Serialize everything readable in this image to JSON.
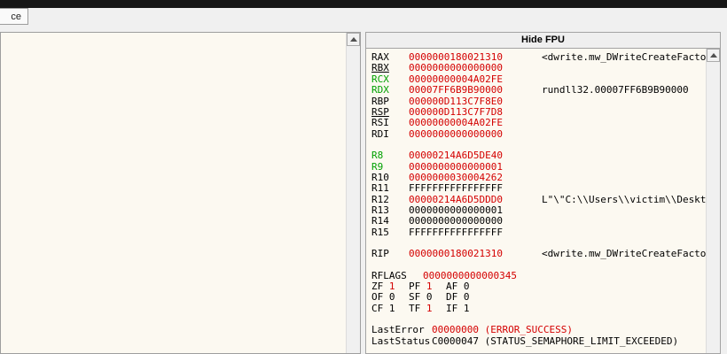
{
  "colors": {
    "red": "#d40000",
    "green": "#00a000",
    "black": "#000000",
    "panel_bg": "#fcf9f1",
    "chrome": "#f0f0f0"
  },
  "tab_fragment": "ce",
  "fpu_button": "Hide FPU",
  "registers": [
    {
      "name": "RAX",
      "name_color": "black",
      "underline": false,
      "value": "0000000180021310",
      "value_color": "red",
      "comment": "<dwrite.mw_DWriteCreateFacto",
      "gap_before": false
    },
    {
      "name": "RBX",
      "name_color": "black",
      "underline": true,
      "value": "0000000000000000",
      "value_color": "red",
      "comment": "",
      "gap_before": false
    },
    {
      "name": "RCX",
      "name_color": "green",
      "underline": false,
      "value": "00000000004A02FE",
      "value_color": "red",
      "comment": "",
      "gap_before": false
    },
    {
      "name": "RDX",
      "name_color": "green",
      "underline": false,
      "value": "00007FF6B9B90000",
      "value_color": "red",
      "comment": "rundll32.00007FF6B9B90000",
      "gap_before": false
    },
    {
      "name": "RBP",
      "name_color": "black",
      "underline": false,
      "value": "000000D113C7F8E0",
      "value_color": "red",
      "comment": "",
      "gap_before": false
    },
    {
      "name": "RSP",
      "name_color": "black",
      "underline": true,
      "value": "000000D113C7F7D8",
      "value_color": "red",
      "comment": "",
      "gap_before": false
    },
    {
      "name": "RSI",
      "name_color": "black",
      "underline": false,
      "value": "00000000004A02FE",
      "value_color": "red",
      "comment": "",
      "gap_before": false
    },
    {
      "name": "RDI",
      "name_color": "black",
      "underline": false,
      "value": "0000000000000000",
      "value_color": "red",
      "comment": "",
      "gap_before": false
    },
    {
      "name": "R8",
      "name_color": "green",
      "underline": false,
      "value": "00000214A6D5DE40",
      "value_color": "red",
      "comment": "",
      "gap_before": true
    },
    {
      "name": "R9",
      "name_color": "green",
      "underline": false,
      "value": "0000000000000001",
      "value_color": "red",
      "comment": "",
      "gap_before": false
    },
    {
      "name": "R10",
      "name_color": "black",
      "underline": false,
      "value": "0000000030004262",
      "value_color": "red",
      "comment": "",
      "gap_before": false
    },
    {
      "name": "R11",
      "name_color": "black",
      "underline": false,
      "value": "FFFFFFFFFFFFFFFF",
      "value_color": "black",
      "comment": "",
      "gap_before": false
    },
    {
      "name": "R12",
      "name_color": "black",
      "underline": false,
      "value": "00000214A6D5DDD0",
      "value_color": "red",
      "comment": "L\"\\\"C:\\\\Users\\\\victim\\\\Deskt",
      "gap_before": false
    },
    {
      "name": "R13",
      "name_color": "black",
      "underline": false,
      "value": "0000000000000001",
      "value_color": "black",
      "comment": "",
      "gap_before": false
    },
    {
      "name": "R14",
      "name_color": "black",
      "underline": false,
      "value": "0000000000000000",
      "value_color": "black",
      "comment": "",
      "gap_before": false
    },
    {
      "name": "R15",
      "name_color": "black",
      "underline": false,
      "value": "FFFFFFFFFFFFFFFF",
      "value_color": "black",
      "comment": "",
      "gap_before": false
    },
    {
      "name": "RIP",
      "name_color": "black",
      "underline": false,
      "value": "0000000180021310",
      "value_color": "red",
      "comment": "<dwrite.mw_DWriteCreateFacto",
      "gap_before": true
    }
  ],
  "rflags": {
    "name": "RFLAGS",
    "value": "0000000000000345"
  },
  "flags": [
    [
      {
        "label": "ZF",
        "value": "1",
        "changed": true
      },
      {
        "label": "PF",
        "value": "1",
        "changed": true
      },
      {
        "label": "AF",
        "value": "0",
        "changed": false
      }
    ],
    [
      {
        "label": "OF",
        "value": "0",
        "changed": false
      },
      {
        "label": "SF",
        "value": "0",
        "changed": false
      },
      {
        "label": "DF",
        "value": "0",
        "changed": false
      }
    ],
    [
      {
        "label": "CF",
        "value": "1",
        "changed": false
      },
      {
        "label": "TF",
        "value": "1",
        "changed": true
      },
      {
        "label": "IF",
        "value": "1",
        "changed": false
      }
    ]
  ],
  "status": [
    {
      "label": "LastError",
      "value": "00000000",
      "note": "(ERROR_SUCCESS)",
      "changed": true
    },
    {
      "label": "LastStatus",
      "value": "C0000047",
      "note": "(STATUS_SEMAPHORE_LIMIT_EXCEEDED)",
      "changed": false
    }
  ]
}
